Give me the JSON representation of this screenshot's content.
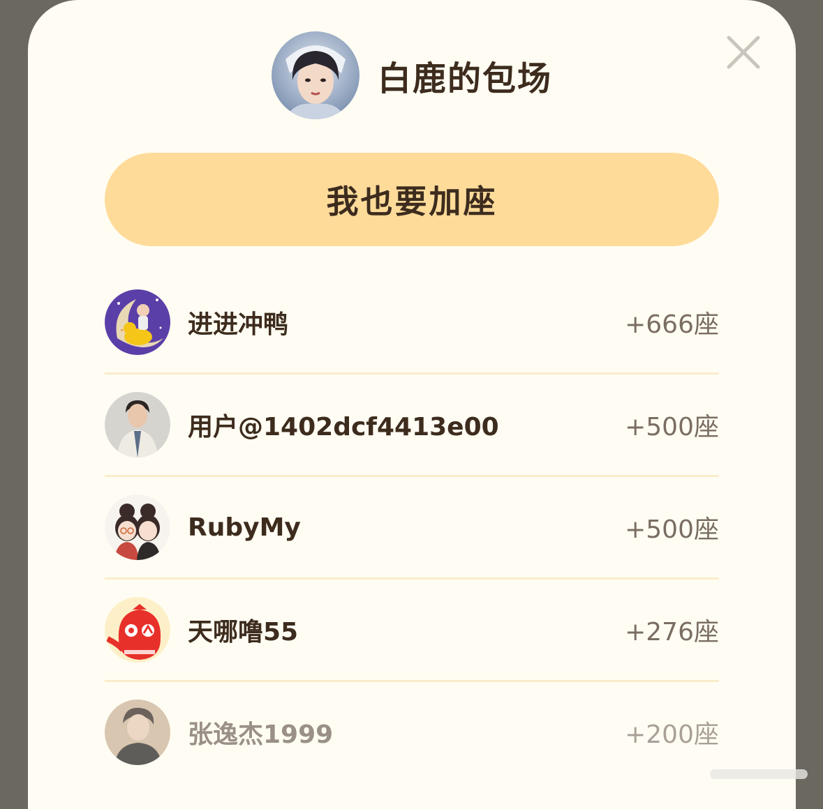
{
  "header": {
    "title": "白鹿的包场",
    "avatar_icon": "host-portrait-avatar",
    "close_icon": "close-icon"
  },
  "join_button": {
    "label": "我也要加座"
  },
  "supporters": [
    {
      "name": "进进冲鸭",
      "seats": "+666座",
      "avatar": "duck-moon-avatar"
    },
    {
      "name": "用户@1402dcf4413e00",
      "seats": "+500座",
      "avatar": "man-suit-avatar"
    },
    {
      "name": "RubyMy",
      "seats": "+500座",
      "avatar": "cartoon-couple-avatar"
    },
    {
      "name": "天哪噜55",
      "seats": "+276座",
      "avatar": "red-mascot-avatar"
    },
    {
      "name": "张逸杰1999",
      "seats": "+200座",
      "avatar": "man-portrait-avatar"
    }
  ],
  "colors": {
    "sheet_bg": "#fffdf3",
    "button_bg": "#ffdb9a",
    "text_dark": "#3d2c1e",
    "divider": "#fbeccb",
    "overlay": "#6b6860"
  }
}
